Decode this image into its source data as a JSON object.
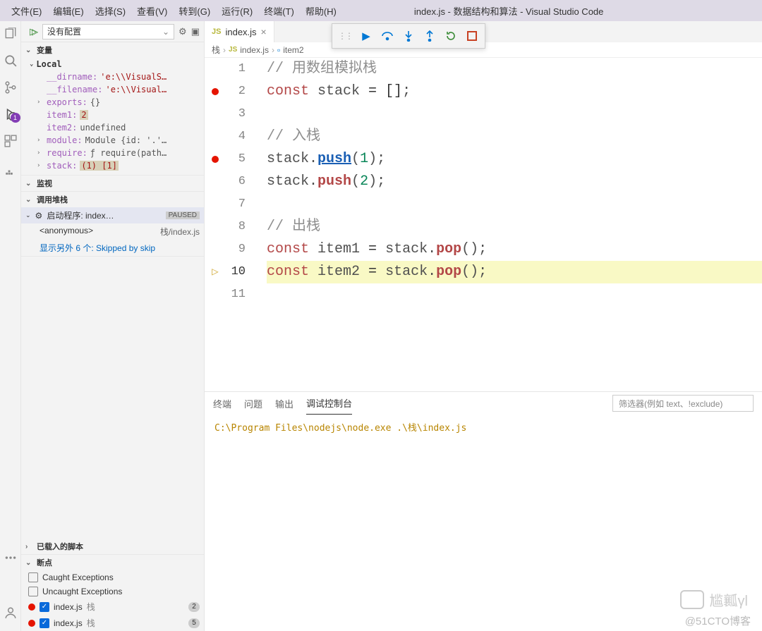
{
  "menubar": {
    "items": [
      "文件(E)",
      "编辑(E)",
      "选择(S)",
      "查看(V)",
      "转到(G)",
      "运行(R)",
      "终端(T)",
      "帮助(H)"
    ],
    "title": "index.js - 数据结构和算法 - Visual Studio Code"
  },
  "toolbar": {
    "config": "没有配置",
    "settings_icon": "⚙",
    "console_icon": "▣"
  },
  "debug_controls": [
    "continue",
    "step-over",
    "step-into",
    "step-out",
    "restart",
    "stop"
  ],
  "panels": {
    "variables": {
      "title": "变量"
    },
    "local": {
      "title": "Local",
      "rows": [
        {
          "name": "__dirname",
          "value": "'e:\\\\VisualS…",
          "kind": "str"
        },
        {
          "name": "__filename",
          "value": "'e:\\\\Visual…",
          "kind": "str"
        },
        {
          "name": "exports",
          "value": "{}",
          "kind": "ref",
          "expandable": true
        },
        {
          "name": "item1",
          "value": "2",
          "kind": "hl"
        },
        {
          "name": "item2",
          "value": "undefined",
          "kind": "ref"
        },
        {
          "name": "module",
          "value": "Module {id: '.'…",
          "kind": "ref",
          "expandable": true
        },
        {
          "name": "require",
          "value": "ƒ require(path…",
          "kind": "ref",
          "expandable": true
        },
        {
          "name": "stack",
          "value": "(1) [1]",
          "kind": "hl",
          "expandable": true
        }
      ]
    },
    "watch": {
      "title": "监视"
    },
    "callstack": {
      "title": "调用堆栈",
      "top": {
        "name": "启动程序: index…",
        "state": "PAUSED"
      },
      "frame": {
        "label": "<anonymous>",
        "loc": "栈/index.js"
      },
      "skipped": "显示另外 6 个: Skipped by skip"
    },
    "loaded": {
      "title": "已载入的脚本"
    },
    "breakpoints": {
      "title": "断点",
      "rows": [
        {
          "label": "Caught Exceptions",
          "checked": false
        },
        {
          "label": "Uncaught Exceptions",
          "checked": false
        },
        {
          "label": "index.js",
          "sub": "栈",
          "checked": true,
          "dot": true,
          "count": "2"
        },
        {
          "label": "index.js",
          "sub": "栈",
          "checked": true,
          "dot": true,
          "count": "5"
        }
      ]
    }
  },
  "tab": {
    "icon": "JS",
    "label": "index.js"
  },
  "breadcrumb": {
    "root": "栈",
    "file": "index.js",
    "symbol": "item2",
    "file_icon": "JS"
  },
  "code": {
    "lines": [
      {
        "n": 1,
        "bp": false,
        "cur": false,
        "tokens": [
          {
            "t": "comment",
            "s": "// 用数组模拟栈"
          }
        ]
      },
      {
        "n": 2,
        "bp": true,
        "cur": false,
        "tokens": [
          {
            "t": "keyword",
            "s": "const"
          },
          {
            "t": "raw",
            "s": " "
          },
          {
            "t": "ident",
            "s": "stack"
          },
          {
            "t": "raw",
            "s": " = []"
          },
          {
            "t": "punc",
            "s": ";"
          }
        ]
      },
      {
        "n": 3,
        "bp": false,
        "cur": false,
        "tokens": []
      },
      {
        "n": 4,
        "bp": false,
        "cur": false,
        "tokens": [
          {
            "t": "comment",
            "s": "// 入栈"
          }
        ]
      },
      {
        "n": 5,
        "bp": true,
        "cur": false,
        "tokens": [
          {
            "t": "ident",
            "s": "stack"
          },
          {
            "t": "punc",
            "s": "."
          },
          {
            "t": "func-u",
            "s": "push"
          },
          {
            "t": "punc",
            "s": "("
          },
          {
            "t": "num",
            "s": "1"
          },
          {
            "t": "punc",
            "s": ");"
          }
        ]
      },
      {
        "n": 6,
        "bp": false,
        "cur": false,
        "tokens": [
          {
            "t": "ident",
            "s": "stack"
          },
          {
            "t": "punc",
            "s": "."
          },
          {
            "t": "func",
            "s": "push"
          },
          {
            "t": "punc",
            "s": "("
          },
          {
            "t": "num",
            "s": "2"
          },
          {
            "t": "punc",
            "s": ");"
          }
        ]
      },
      {
        "n": 7,
        "bp": false,
        "cur": false,
        "tokens": []
      },
      {
        "n": 8,
        "bp": false,
        "cur": false,
        "tokens": [
          {
            "t": "comment",
            "s": "// 出栈"
          }
        ]
      },
      {
        "n": 9,
        "bp": false,
        "cur": false,
        "tokens": [
          {
            "t": "keyword",
            "s": "const"
          },
          {
            "t": "raw",
            "s": " "
          },
          {
            "t": "ident",
            "s": "item1"
          },
          {
            "t": "raw",
            "s": " = "
          },
          {
            "t": "ident",
            "s": "stack"
          },
          {
            "t": "punc",
            "s": "."
          },
          {
            "t": "func",
            "s": "pop"
          },
          {
            "t": "punc",
            "s": "();"
          }
        ]
      },
      {
        "n": 10,
        "bp": false,
        "cur": true,
        "tokens": [
          {
            "t": "keyword",
            "s": "const"
          },
          {
            "t": "raw",
            "s": " "
          },
          {
            "t": "ident",
            "s": "item2"
          },
          {
            "t": "raw",
            "s": " = "
          },
          {
            "t": "ident",
            "s": "stack"
          },
          {
            "t": "punc",
            "s": "."
          },
          {
            "t": "func",
            "s": "pop"
          },
          {
            "t": "punc",
            "s": "();"
          }
        ]
      },
      {
        "n": 11,
        "bp": false,
        "cur": false,
        "tokens": []
      }
    ]
  },
  "terminal": {
    "tabs": [
      "终端",
      "问题",
      "输出",
      "调试控制台"
    ],
    "active_tab": 3,
    "filter_placeholder": "筛选器(例如 text、!exclude)",
    "output": "C:\\Program Files\\nodejs\\node.exe .\\栈\\index.js"
  },
  "watermark": {
    "name": "尴瓤γl",
    "credit": "@51CTO博客"
  }
}
